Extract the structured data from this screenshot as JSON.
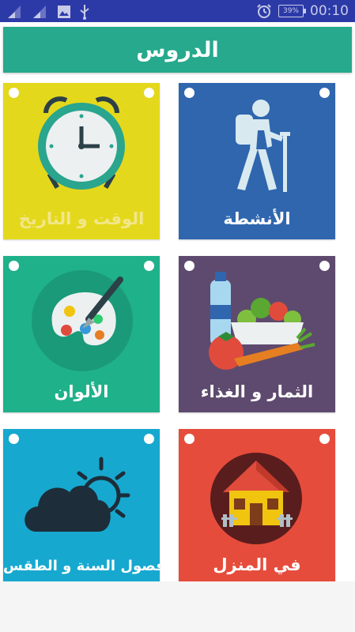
{
  "status_bar": {
    "time": "00:10",
    "battery": "39%",
    "icons": [
      "signal-icon",
      "signal-icon",
      "image-icon",
      "usb-icon",
      "alarm-icon",
      "battery-icon"
    ]
  },
  "header": {
    "title": "الدروس"
  },
  "lessons": [
    {
      "label": "الوقت و التاريخ",
      "icon": "alarm-clock-icon",
      "color": "#e4d81c"
    },
    {
      "label": "الأنشطة",
      "icon": "hiker-icon",
      "color": "#2f66ae"
    },
    {
      "label": "الألوان",
      "icon": "palette-icon",
      "color": "#1fb18a"
    },
    {
      "label": "الثمار و الغذاء",
      "icon": "food-icon",
      "color": "#5e4a6e"
    },
    {
      "label": "فصول السنة و الطقس",
      "icon": "weather-icon",
      "color": "#17a8cf"
    },
    {
      "label": "في المنزل",
      "icon": "house-icon",
      "color": "#e64c3c"
    }
  ]
}
